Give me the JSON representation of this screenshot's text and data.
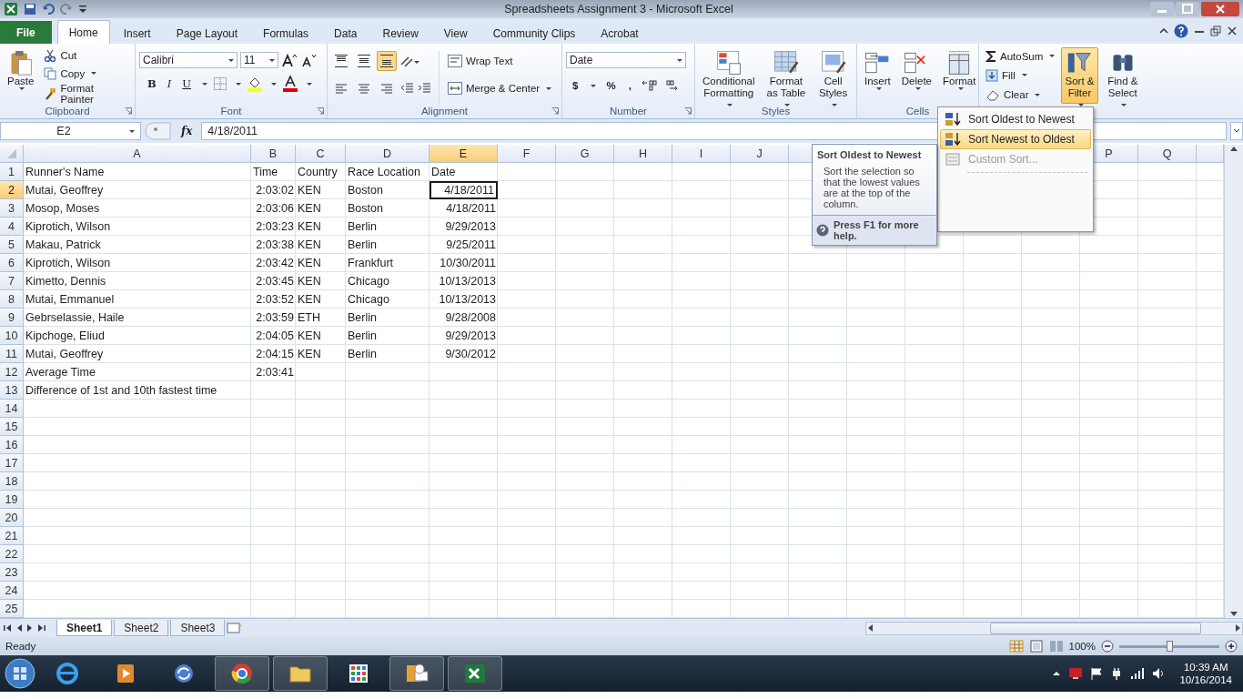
{
  "window": {
    "title": "Spreadsheets Assignment 3 - Microsoft Excel"
  },
  "tabs": [
    {
      "label": "File",
      "selected": false,
      "kind": "file"
    },
    {
      "label": "Home",
      "selected": true,
      "kind": "tab"
    },
    {
      "label": "Insert",
      "selected": false,
      "kind": "tab"
    },
    {
      "label": "Page Layout",
      "selected": false,
      "kind": "tab"
    },
    {
      "label": "Formulas",
      "selected": false,
      "kind": "tab"
    },
    {
      "label": "Data",
      "selected": false,
      "kind": "tab"
    },
    {
      "label": "Review",
      "selected": false,
      "kind": "tab"
    },
    {
      "label": "View",
      "selected": false,
      "kind": "tab"
    },
    {
      "label": "Community Clips",
      "selected": false,
      "kind": "tab"
    },
    {
      "label": "Acrobat",
      "selected": false,
      "kind": "tab"
    }
  ],
  "ribbon": {
    "clipboard": {
      "label": "Clipboard",
      "paste": "Paste",
      "cut": "Cut",
      "copy": "Copy",
      "format_painter": "Format Painter"
    },
    "font": {
      "label": "Font",
      "font_name": "Calibri",
      "font_size": "11",
      "bold": "B",
      "italic": "I",
      "underline": "U"
    },
    "alignment": {
      "label": "Alignment",
      "wrap_text": "Wrap Text",
      "merge_center": "Merge & Center",
      "vertical_align": [
        {
          "selected": false
        },
        {
          "selected": false
        },
        {
          "selected": true
        }
      ]
    },
    "number": {
      "label": "Number",
      "format": "Date",
      "currency": "$",
      "percent": "%",
      "comma": ","
    },
    "styles": {
      "label": "Styles",
      "buttons": [
        {
          "lines": [
            "Conditional",
            "Formatting"
          ]
        },
        {
          "lines": [
            "Format",
            "as Table"
          ]
        },
        {
          "lines": [
            "Cell",
            "Styles"
          ]
        }
      ]
    },
    "cells": {
      "label": "Cells",
      "buttons": [
        "Insert",
        "Delete",
        "Format"
      ]
    },
    "editing": {
      "autosum": "AutoSum",
      "fill": "Fill",
      "clear": "Clear",
      "sort_filter": {
        "lines": [
          "Sort &",
          "Filter"
        ],
        "pressed": true
      },
      "find_select": {
        "lines": [
          "Find &",
          "Select"
        ],
        "pressed": false
      }
    }
  },
  "formula_bar": {
    "name_box": "E2",
    "function_label": "fx",
    "value": "4/18/2011"
  },
  "column_headers": [
    {
      "label": "A",
      "selected": false
    },
    {
      "label": "B",
      "selected": false
    },
    {
      "label": "C",
      "selected": false
    },
    {
      "label": "D",
      "selected": false
    },
    {
      "label": "E",
      "selected": true
    },
    {
      "label": "F",
      "selected": false
    },
    {
      "label": "G",
      "selected": false
    },
    {
      "label": "H",
      "selected": false
    },
    {
      "label": "I",
      "selected": false
    },
    {
      "label": "J",
      "selected": false
    }
  ],
  "column_headers_right": [
    {
      "label": "P"
    },
    {
      "label": "Q"
    }
  ],
  "rows": [
    {
      "header": "1",
      "selected": false,
      "cells": [
        "Runner's Name",
        "Time",
        "Country",
        "Race Location",
        "Date"
      ]
    },
    {
      "header": "2",
      "selected": true,
      "cells": [
        "Mutai, Geoffrey",
        "2:03:02",
        "KEN",
        "Boston",
        "4/18/2011"
      ]
    },
    {
      "header": "3",
      "selected": false,
      "cells": [
        "Mosop, Moses",
        "2:03:06",
        "KEN",
        "Boston",
        "4/18/2011"
      ]
    },
    {
      "header": "4",
      "selected": false,
      "cells": [
        "Kiprotich, Wilson",
        "2:03:23",
        "KEN",
        "Berlin",
        "9/29/2013"
      ]
    },
    {
      "header": "5",
      "selected": false,
      "cells": [
        "Makau, Patrick",
        "2:03:38",
        "KEN",
        "Berlin",
        "9/25/2011"
      ]
    },
    {
      "header": "6",
      "selected": false,
      "cells": [
        "Kiprotich, Wilson",
        "2:03:42",
        "KEN",
        "Frankfurt",
        "10/30/2011"
      ]
    },
    {
      "header": "7",
      "selected": false,
      "cells": [
        "Kimetto, Dennis",
        "2:03:45",
        "KEN",
        "Chicago",
        "10/13/2013"
      ]
    },
    {
      "header": "8",
      "selected": false,
      "cells": [
        "Mutai, Emmanuel",
        "2:03:52",
        "KEN",
        "Chicago",
        "10/13/2013"
      ]
    },
    {
      "header": "9",
      "selected": false,
      "cells": [
        "Gebrselassie, Haile",
        "2:03:59",
        "ETH",
        "Berlin",
        "9/28/2008"
      ]
    },
    {
      "header": "10",
      "selected": false,
      "cells": [
        "Kipchoge, Eliud",
        "2:04:05",
        "KEN",
        "Berlin",
        "9/29/2013"
      ]
    },
    {
      "header": "11",
      "selected": false,
      "cells": [
        "Mutai, Geoffrey",
        "2:04:15",
        "KEN",
        "Berlin",
        "9/30/2012"
      ]
    },
    {
      "header": "12",
      "selected": false,
      "cells": [
        "Average Time",
        "2:03:41"
      ]
    },
    {
      "header": "13",
      "selected": false,
      "cells": [
        "Difference of 1st and 10th fastest time"
      ]
    },
    {
      "header": "14",
      "selected": false
    },
    {
      "header": "15",
      "selected": false
    },
    {
      "header": "16",
      "selected": false
    },
    {
      "header": "17",
      "selected": false
    },
    {
      "header": "18",
      "selected": false
    },
    {
      "header": "19",
      "selected": false
    },
    {
      "header": "20",
      "selected": false
    },
    {
      "header": "21",
      "selected": false
    },
    {
      "header": "22",
      "selected": false
    },
    {
      "header": "23",
      "selected": false
    },
    {
      "header": "24",
      "selected": false
    },
    {
      "header": "25",
      "selected": false
    }
  ],
  "sort_menu": {
    "items": [
      {
        "label": "Sort Oldest to Newest",
        "kind": "asc",
        "selected": false
      },
      {
        "label": "Sort Newest to Oldest",
        "kind": "desc",
        "selected": true
      },
      {
        "label": "Custom Sort...",
        "kind": "custom",
        "selected": false,
        "disabled": true
      }
    ]
  },
  "tooltip": {
    "title": "Sort Oldest to Newest",
    "body": "Sort the selection so that the lowest values are at the top of the column.",
    "help": "Press F1 for more help."
  },
  "sheet_tabs": [
    {
      "label": "Sheet1",
      "selected": true
    },
    {
      "label": "Sheet2",
      "selected": false
    },
    {
      "label": "Sheet3",
      "selected": false
    }
  ],
  "status_bar": {
    "status": "Ready",
    "zoom": "100%",
    "zoom_slider": {
      "level": 0.5
    }
  },
  "taskbar": {
    "apps": [
      {
        "kind": "ie",
        "active": false
      },
      {
        "kind": "media",
        "active": false
      },
      {
        "kind": "sync",
        "active": false
      },
      {
        "kind": "chrome",
        "active": true
      },
      {
        "kind": "folder",
        "active": true
      },
      {
        "kind": "grid",
        "active": false
      },
      {
        "kind": "outlook",
        "active": true
      },
      {
        "kind": "excel",
        "active": true
      }
    ],
    "time": "10:39 AM",
    "date": "10/16/2014"
  }
}
